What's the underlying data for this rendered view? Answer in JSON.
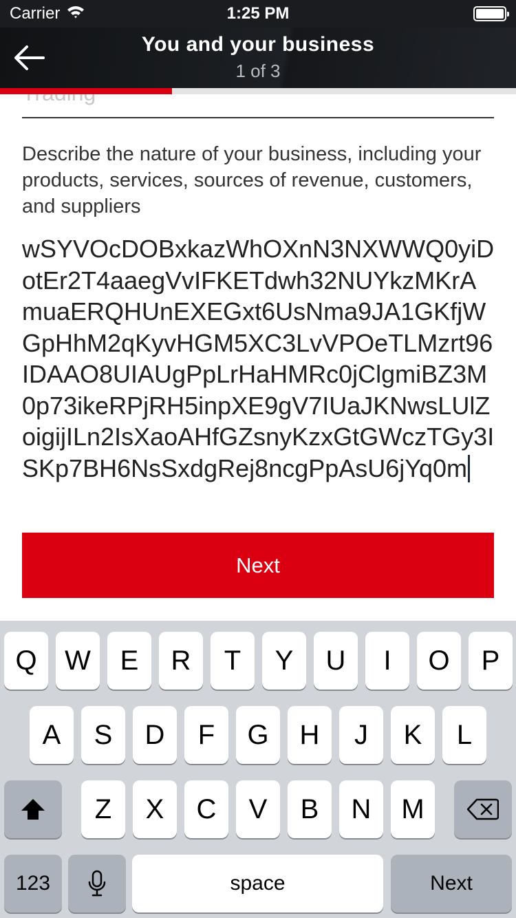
{
  "status_bar": {
    "carrier": "Carrier",
    "time": "1:25 PM",
    "battery_percent": 100
  },
  "nav": {
    "title": "You and your business",
    "step": "1 of 3",
    "back_icon": "arrow-left-icon"
  },
  "progress": {
    "fraction": 0.333,
    "color": "#db0011"
  },
  "form": {
    "previous_field_fragment": "Trading",
    "field_label": "Describe the nature of your business, including your products, services, sources of revenue, customers, and suppliers",
    "field_value": "wSYVOcDOBxkazWhOXnN3NXWWQ0yiDotEr2T4aaegVvIFKETdwh32NUYkzMKrAmuaERQHUnEXEGxt6UsNma9JA1GKfjWGpHhM2qKyvHGM5XC3LvVPOeTLMzrt96IDAAO8UIAUgPpLrHaHMRc0jClgmiBZ3M0p73ikeRPjRH5inpXE9gV7IUaJKNwsLUlZoigijILn2IsXaoAHfGZsnyKzxGtGWczTGy3ISKp7BH6NsSxdgRej8ncgPpAsU6jYq0m",
    "next_label": "Next",
    "accent_color": "#db0011"
  },
  "keyboard": {
    "row1": [
      "Q",
      "W",
      "E",
      "R",
      "T",
      "Y",
      "U",
      "I",
      "O",
      "P"
    ],
    "row2": [
      "A",
      "S",
      "D",
      "F",
      "G",
      "H",
      "J",
      "K",
      "L"
    ],
    "row3": [
      "Z",
      "X",
      "C",
      "V",
      "B",
      "N",
      "M"
    ],
    "numbers_label": "123",
    "space_label": "space",
    "return_label": "Next",
    "shift_icon": "shift-arrow-icon",
    "delete_icon": "backspace-icon",
    "mic_icon": "microphone-icon"
  }
}
